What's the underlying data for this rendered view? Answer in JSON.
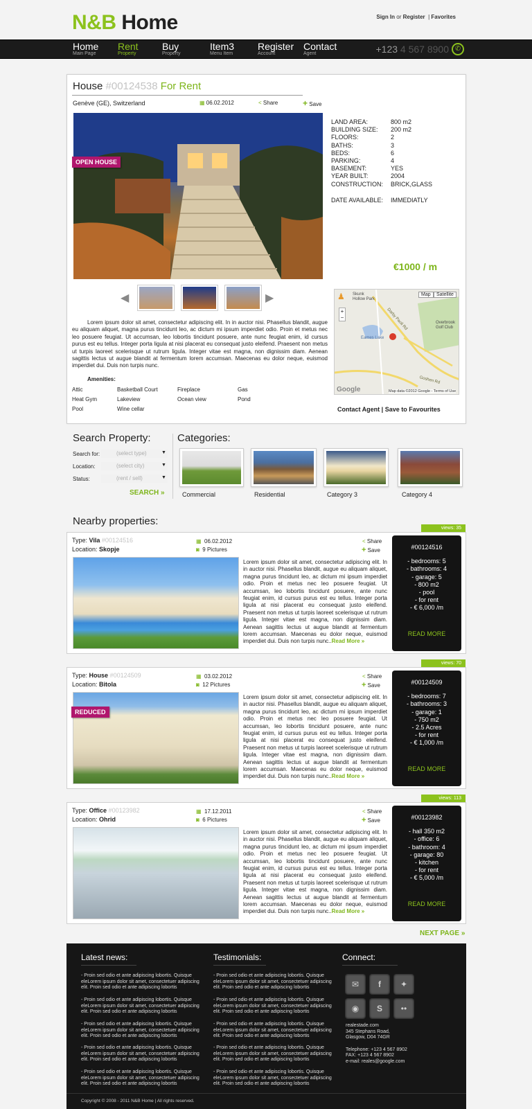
{
  "header": {
    "logo_nb": "N&B",
    "logo_home": "Home",
    "sign_in": "Sign In",
    "or": "or",
    "register": "Register",
    "sep": "|",
    "favorites": "Favorites",
    "phone_prefix": "+123",
    "phone_rest": "4 567 8900"
  },
  "nav": [
    {
      "title": "Home",
      "sub": "Main Page"
    },
    {
      "title": "Rent",
      "sub": "Property"
    },
    {
      "title": "Buy",
      "sub": "Property"
    },
    {
      "title": "Item3",
      "sub": "Menu Item"
    },
    {
      "title": "Register",
      "sub": "Account"
    },
    {
      "title": "Contact",
      "sub": "Agent"
    }
  ],
  "listing": {
    "type": "House",
    "id": "#00124538",
    "status": "For Rent",
    "location": "Genève (GE), Switzerland",
    "date": "06.02.2012",
    "share": "Share",
    "save": "Save",
    "badge": "OPEN HOUSE",
    "specs": [
      {
        "k": "LAND AREA:",
        "v": "800 m2"
      },
      {
        "k": "BUILDING SIZE:",
        "v": "200 m2"
      },
      {
        "k": "FLOORS:",
        "v": "2"
      },
      {
        "k": "BATHS:",
        "v": "3"
      },
      {
        "k": "BEDS:",
        "v": "6"
      },
      {
        "k": "PARKING:",
        "v": "4"
      },
      {
        "k": "BASEMENT:",
        "v": "YES"
      },
      {
        "k": "YEAR BUILT:",
        "v": "2004"
      },
      {
        "k": "CONSTRUCTION:",
        "v": "BRICK,GLASS"
      }
    ],
    "date_available_k": "DATE AVAILABLE:",
    "date_available_v": "IMMEDIATLY",
    "price": "€1000 / m",
    "description": "Lorem ipsum dolor sit amet, consectetur adipiscing elit. In in auctor nisi. Phasellus blandit, augue eu aliquam aliquet, magna purus tincidunt leo, ac dictum mi ipsum imperdiet odio. Proin et metus nec leo posuere feugiat. Ut accumsan, leo lobortis tincidunt posuere, ante nunc feugiat enim, id cursus purus est eu tellus. Integer porta ligula at nisi placerat eu consequat justo eleifend. Praesent non metus ut turpis laoreet scelerisque ut rutrum ligula. Integer vitae est magna, non dignissim diam. Aenean sagittis lectus ut augue blandit at fermentum lorem accumsan. Maecenas eu dolor neque, euismod imperdiet dui. Duis non turpis nunc.",
    "amenities_title": "Amenities:",
    "amenities": [
      [
        "Attic",
        "Basketball Court",
        "Fireplace",
        "Gas"
      ],
      [
        "Heat Gym",
        "Lakeview",
        "Ocean view",
        "Pond"
      ],
      [
        "Pool",
        "Wine cellar",
        "",
        ""
      ]
    ],
    "contact_agent": "Contact Agent",
    "save_fav": "Save to Favourites",
    "map": {
      "btn_map": "Map",
      "btn_sat": "Satellite",
      "l1": "Skunk Hollow Park",
      "l2": "Overbrook Golf Club",
      "l3": "Eames Lake",
      "l4": "Darby Paoli Rd",
      "l5": "Goshen Rd",
      "google": "Google",
      "credit": "Map data ©2012 Google - Terms of Use"
    }
  },
  "search": {
    "title": "Search Property:",
    "fields": [
      {
        "label": "Search for:",
        "value": "(select type)"
      },
      {
        "label": "Location:",
        "value": "(select city)"
      },
      {
        "label": "Status:",
        "value": "(rent / sell)"
      }
    ],
    "button": "SEARCH »"
  },
  "categories": {
    "title": "Categories:",
    "items": [
      "Commercial",
      "Residential",
      "Category 3",
      "Category 4"
    ]
  },
  "nearby": {
    "title": "Nearby properties:",
    "type_label": "Type:",
    "location_label": "Location:",
    "share": "Share",
    "save": "Save",
    "read_more_inline": "Read More »",
    "read_more": "READ MORE",
    "text": "Lorem ipsum dolor sit amet, consectetur adipiscing elit. In in auctor nisi. Phasellus blandit, augue eu aliquam aliquet, magna purus tincidunt leo, ac dictum mi ipsum imperdiet odio. Proin et metus nec leo posuere feugiat. Ut accumsan, leo lobortis tincidunt posuere, ante nunc feugiat enim, id cursus purus est eu tellus. Integer porta ligula at nisi placerat eu consequat justo eleifend. Praesent non metus ut turpis laoreet scelerisque ut rutrum ligula. Integer vitae est magna, non dignissim diam. Aenean sagittis lectus ut augue blandit at fermentum lorem accumsan. Maecenas eu dolor neque, euismod imperdiet dui. Duis non turpis nunc..",
    "items": [
      {
        "views": "views: 35",
        "type": "Vila",
        "id": "#00124516",
        "location": "Skopje",
        "date": "06.02.2012",
        "pictures": "9 Pictures",
        "badge": "",
        "box_id": "#00124516",
        "features": [
          "- bedrooms: 5",
          "- bathrooms: 4",
          "- garage: 5",
          "- 800 m2",
          "- pool",
          "- for rent",
          "- € 6,000 /m"
        ]
      },
      {
        "views": "views: 70",
        "type": "House",
        "id": "#00124509",
        "location": "Bitola",
        "date": "03.02.2012",
        "pictures": "12 Pictures",
        "badge": "REDUCED",
        "box_id": "#00124509",
        "features": [
          "- bedrooms: 7",
          "- bathrooms: 3",
          "- garage: 1",
          "- 750 m2",
          "- 2.5 Acres",
          "- for rent",
          "- € 1,000 /m"
        ]
      },
      {
        "views": "views: 113",
        "type": "Office",
        "id": "#00123982",
        "location": "Ohrid",
        "date": "17.12.2011",
        "pictures": "6 Pictures",
        "badge": "",
        "box_id": "#00123982",
        "features": [
          "- hall 350 m2",
          "- office: 6",
          "- bathroom: 4",
          "- garage: 80",
          "- kitchen",
          "- for rent",
          "- € 5,000 /m"
        ]
      }
    ]
  },
  "next_page": "NEXT PAGE »",
  "footer": {
    "news_title": "Latest news:",
    "testimonials_title": "Testimonials:",
    "connect_title": "Connect:",
    "news_item": "- Proin sed odio et ante adipiscing lobortis. Quisque eleLorem ipsum dolor sit amet, consectetuer adipiscing elit. Proin sed odio et ante adipiscing lobortis",
    "address": [
      "realestade.com",
      "345 Stephans Road,",
      "Glasgow, D04 74GR"
    ],
    "phones": [
      "Telephone: +123 4 567 8902",
      "FAX: +123 4 567 8902",
      "e-mail: reales@google.com"
    ],
    "copyright": "Copyright © 2008 - 2011 N&B Home  |  All rights reserved."
  }
}
